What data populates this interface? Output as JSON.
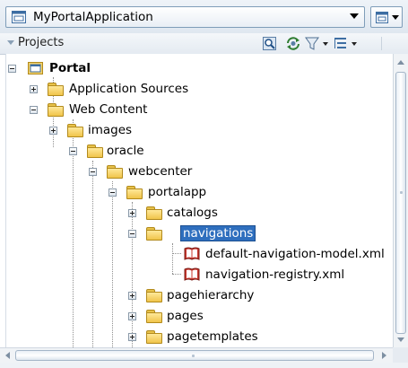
{
  "app_selector": {
    "value": "MyPortalApplication",
    "icon": "application-icon",
    "menu_icon": "application-menu-icon"
  },
  "projects_panel": {
    "title": "Projects",
    "toolbar": [
      "find-icon",
      "refresh-icon",
      "filter-icon",
      "sort-icon"
    ]
  },
  "tree": {
    "root": "Portal",
    "application_sources": "Application Sources",
    "web_content": "Web Content",
    "images": "images",
    "oracle": "oracle",
    "webcenter": "webcenter",
    "portalapp": "portalapp",
    "catalogs": "catalogs",
    "navigations": "navigations",
    "nav_model_file": "default-navigation-model.xml",
    "nav_registry_file": "navigation-registry.xml",
    "pagehierarchy": "pagehierarchy",
    "pages": "pages",
    "pagetemplates": "pagetemplates"
  },
  "colors": {
    "selection": "#2f6fbe",
    "folder": "#f0c44a",
    "header_bg": "#e4eaf1"
  }
}
